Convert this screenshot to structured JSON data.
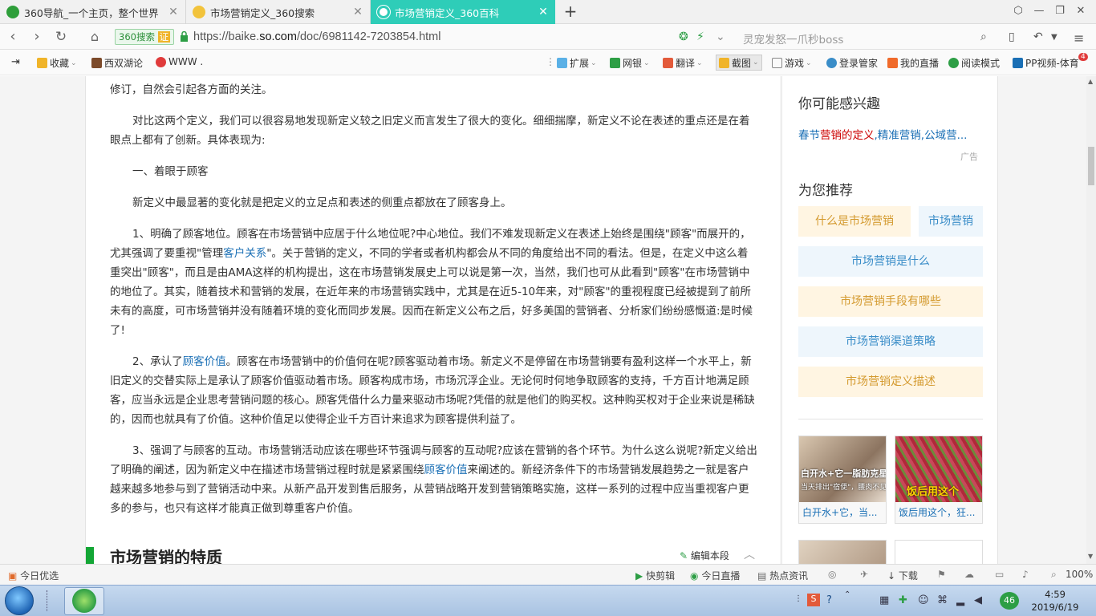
{
  "tabs": [
    {
      "title": "360导航_一个主页，整个世界",
      "color": "#2e9e3a"
    },
    {
      "title": "市场营销定义_360搜索",
      "color": "#f2c33b"
    },
    {
      "title": "市场营销定义_360百科",
      "color": "#ffffff"
    }
  ],
  "address": {
    "cert": "360搜索",
    "cert_mark": "证",
    "url_prefix": "https://baike.",
    "url_host": "so.com",
    "url_path": "/doc/6981142-7203854.html",
    "search_placeholder": "灵宠发怒一爪秒boss"
  },
  "bookmarks": {
    "favorites": "收藏",
    "xishuang": "西双湖论",
    "www": "WWW .",
    "extensions": "扩展",
    "netbank": "网银",
    "translate": "翻译",
    "screenshot": "截图",
    "games": "游戏",
    "login": "登录管家",
    "live": "我的直播",
    "reader": "阅读模式",
    "pp": "PP视频-体育",
    "pp_badge": "4"
  },
  "article": {
    "p0": "修订，自然会引起各方面的关注。",
    "p1": "对比这两个定义，我们可以很容易地发现新定义较之旧定义而言发生了很大的变化。细细揣摩，新定义不论在表述的重点还是在着眼点上都有了创新。具体表现为:",
    "p2": "一、着眼于顾客",
    "p3": "新定义中最显著的变化就是把定义的立足点和表述的侧重点都放在了顾客身上。",
    "p4a": "1、明确了顾客地位。顾客在市场营销中应居于什么地位呢?中心地位。我们不难发现新定义在表述上始终是围绕\"顾客\"而展开的，尤其强调了要重视\"管理",
    "p4link": "客户关系",
    "p4b": "\"。关于营销的定义，不同的学者或者机构都会从不同的角度给出不同的看法。但是，在定义中这么着重突出\"顾客\"，而且是由AMA这样的机构提出，这在市场营销发展史上可以说是第一次，当然，我们也可从此看到\"顾客\"在市场营销中的地位了。其实，随着技术和营销的发展，在近年来的市场营销实践中，尤其是在近5-10年来，对\"顾客\"的重视程度已经被提到了前所未有的高度，可市场营销并没有随着环境的变化而同步发展。因而在新定义公布之后，好多美国的营销者、分析家们纷纷感慨道:是时候了!",
    "p5a": "2、承认了",
    "p5link": "顾客价值",
    "p5b": "。顾客在市场营销中的价值何在呢?顾客驱动着市场。新定义不是停留在市场营销要有盈利这样一个水平上，新旧定义的交替实际上是承认了顾客价值驱动着市场。顾客构成市场，市场沉浮企业。无论何时何地争取顾客的支持，千方百计地满足顾客，应当永远是企业思考营销问题的核心。顾客凭借什么力量来驱动市场呢?凭借的就是他们的购买权。这种购买权对于企业来说是稀缺的，因而也就具有了价值。这种价值足以使得企业千方百计来追求为顾客提供利益了。",
    "p6a": "3、强调了与顾客的互动。市场营销活动应该在哪些环节强调与顾客的互动呢?应该在营销的各个环节。为什么这么说呢?新定义给出了明确的阐述，因为新定义中在描述市场营销过程时就是紧紧围绕",
    "p6link": "顾客价值",
    "p6b": "来阐述的。新经济条件下的市场营销发展趋势之一就是客户越来越多地参与到了营销活动中来。从新产品开发到售后服务，从营销战略开发到营销策略实施，这样一系列的过程中应当重视客户更多的参与，也只有这样才能真正做到尊重客户价值。",
    "section_title": "市场营销的特质",
    "edit_label": "编辑本段"
  },
  "sidebar": {
    "interest_title": "你可能感兴趣",
    "interest_pre": "春节",
    "interest_hl": "营销的定义",
    "interest_post": ",精准营销,公域营...",
    "ad": "广告",
    "rec_title": "为您推荐",
    "recs": [
      "什么是市场营销",
      "市场营销",
      "市场营销是什么",
      "市场营销手段有哪些",
      "市场营销渠道策略",
      "市场营销定义描述"
    ],
    "thumb1_cap": "白开水+它，当...",
    "thumb1_overlay1": "白开水+它一脂肪克星",
    "thumb1_overlay2": "当天排出\"宿便\"，腰肉不见了",
    "thumb2_cap": "饭后用这个，狂...",
    "thumb2_overlay": "饭后用这个"
  },
  "status": {
    "today": "今日优选",
    "quick_edit": "快剪辑",
    "live": "今日直播",
    "hot": "热点资讯",
    "download": "下载",
    "zoom": "100%"
  },
  "clock": {
    "time": "4:59",
    "date": "2019/6/19"
  },
  "tray_badge": "46"
}
